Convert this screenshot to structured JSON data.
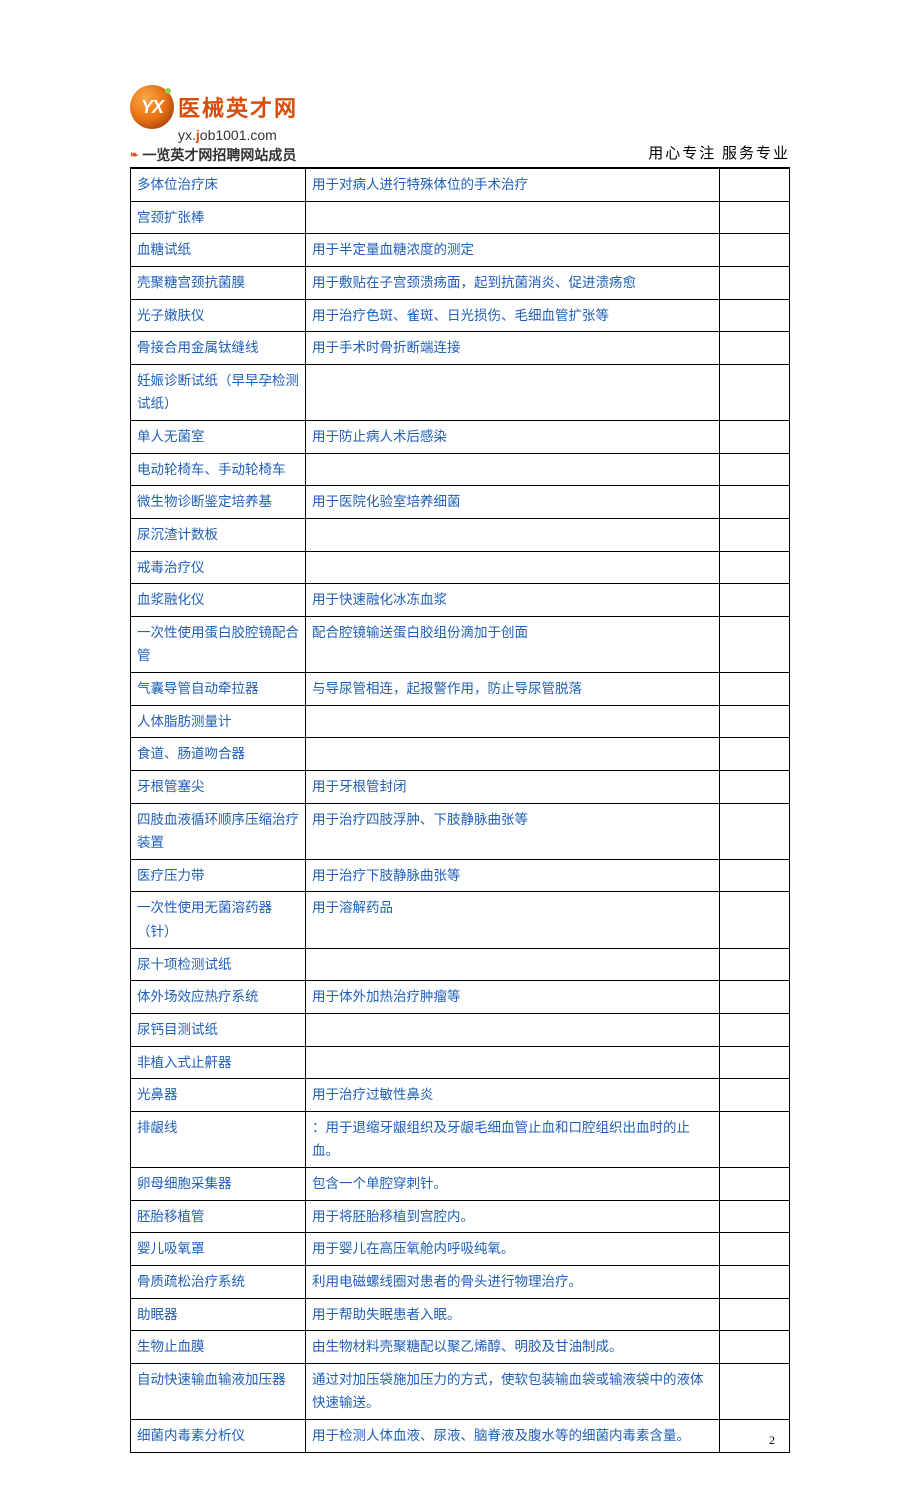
{
  "header": {
    "logo_text": "医械英才网",
    "url_prefix": "yx.",
    "url_j": "j",
    "url_rest": "ob1001",
    "url_suffix": ".com",
    "subtext": "一览英才网招聘网站成员",
    "tagline": "用心专注  服务专业"
  },
  "table_rows": [
    {
      "c1": "多体位治疗床",
      "c2": "用于对病人进行特殊体位的手术治疗",
      "c3": ""
    },
    {
      "c1": "宫颈扩张棒",
      "c2": "",
      "c3": ""
    },
    {
      "c1": "血糖试纸",
      "c2": "用于半定量血糖浓度的测定",
      "c3": ""
    },
    {
      "c1": "壳聚糖宫颈抗菌膜",
      "c2": "用于敷贴在子宫颈溃疡面，起到抗菌消炎、促进溃疡愈",
      "c3": ""
    },
    {
      "c1": "光子嫩肤仪",
      "c2": "用于治疗色斑、雀斑、日光损伤、毛细血管扩张等",
      "c3": ""
    },
    {
      "c1": "骨接合用金属钛缝线",
      "c2": "用于手术时骨折断端连接",
      "c3": ""
    },
    {
      "c1": "妊娠诊断试纸（早早孕检测试纸）",
      "c2": "",
      "c3": ""
    },
    {
      "c1": "单人无菌室",
      "c2": "用于防止病人术后感染",
      "c3": ""
    },
    {
      "c1": "电动轮椅车、手动轮椅车",
      "c2": "",
      "c3": ""
    },
    {
      "c1": "微生物诊断鉴定培养基",
      "c2": "用于医院化验室培养细菌",
      "c3": ""
    },
    {
      "c1": "尿沉渣计数板",
      "c2": "",
      "c3": ""
    },
    {
      "c1": "戒毒治疗仪",
      "c2": "",
      "c3": ""
    },
    {
      "c1": "血浆融化仪",
      "c2": "用于快速融化冰冻血浆",
      "c3": ""
    },
    {
      "c1": "一次性使用蛋白胶腔镜配合管",
      "c2": "配合腔镜输送蛋白胶组份滴加于创面",
      "c3": ""
    },
    {
      "c1": "气囊导管自动牵拉器",
      "c2": "与导尿管相连，起报警作用，防止导尿管脱落",
      "c3": ""
    },
    {
      "c1": "人体脂肪测量计",
      "c2": "",
      "c3": ""
    },
    {
      "c1": "食道、肠道吻合器",
      "c2": "",
      "c3": ""
    },
    {
      "c1": "牙根管塞尖",
      "c2": "用于牙根管封闭",
      "c3": ""
    },
    {
      "c1": "四肢血液循环顺序压缩治疗装置",
      "c2": "用于治疗四肢浮肿、下肢静脉曲张等",
      "c3": ""
    },
    {
      "c1": "医疗压力带",
      "c2": "用于治疗下肢静脉曲张等",
      "c3": ""
    },
    {
      "c1": "一次性使用无菌溶药器（针）",
      "c2": "用于溶解药品",
      "c3": ""
    },
    {
      "c1": "尿十项检测试纸",
      "c2": "",
      "c3": ""
    },
    {
      "c1": "体外场效应热疗系统",
      "c2": "用于体外加热治疗肿瘤等",
      "c3": ""
    },
    {
      "c1": "尿钙目测试纸",
      "c2": "",
      "c3": ""
    },
    {
      "c1": "非植入式止鼾器",
      "c2": "",
      "c3": ""
    },
    {
      "c1": "光鼻器",
      "c2": "用于治疗过敏性鼻炎",
      "c3": ""
    },
    {
      "c1": "排龈线",
      "c2": "：用于退缩牙龈组织及牙龈毛细血管止血和口腔组织出血时的止血。",
      "c3": ""
    },
    {
      "c1": "卵母细胞采集器",
      "c2": "包含一个单腔穿刺针。",
      "c3": ""
    },
    {
      "c1": "胚胎移植管",
      "c2": "用于将胚胎移植到宫腔内。",
      "c3": ""
    },
    {
      "c1": "婴儿吸氧罩",
      "c2": "用于婴儿在高压氧舱内呼吸纯氧。",
      "c3": ""
    },
    {
      "c1": "骨质疏松治疗系统",
      "c2": "利用电磁螺线圈对患者的骨头进行物理治疗。",
      "c3": ""
    },
    {
      "c1": "助眠器",
      "c2": "用于帮助失眠患者入眠。",
      "c3": ""
    },
    {
      "c1": "生物止血膜",
      "c2": "由生物材料壳聚糖配以聚乙烯醇、明胶及甘油制成。",
      "c3": ""
    },
    {
      "c1": "自动快速输血输液加压器",
      "c2": "通过对加压袋施加压力的方式，使软包装输血袋或输液袋中的液体快速输送。",
      "c3": ""
    },
    {
      "c1": "细菌内毒素分析仪",
      "c2": "用于检测人体血液、尿液、脑脊液及腹水等的细菌内毒素含量。",
      "c3": ""
    }
  ],
  "page_number": "2"
}
